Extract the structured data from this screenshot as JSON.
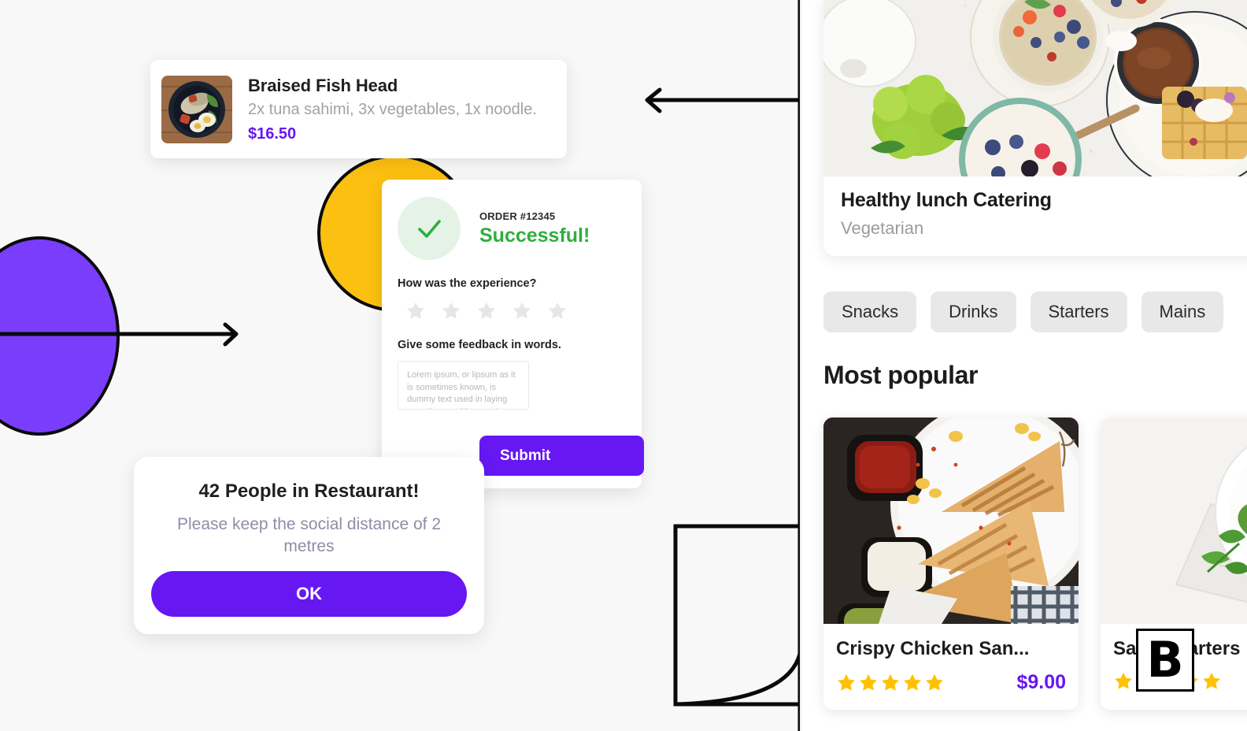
{
  "dish_card": {
    "title": "Braised Fish Head",
    "description": "2x tuna sahimi, 3x vegetables, 1x noodle.",
    "price": "$16.50",
    "thumb_alt": "braised-fish-head-bowl"
  },
  "feedback_card": {
    "order_label": "ORDER #12345",
    "status": "Successful!",
    "status_color": "#2fae3d",
    "rating_question": "How was the experience?",
    "rating_value": 0,
    "rating_max": 5,
    "feedback_label": "Give some feedback in words.",
    "feedback_value": "",
    "feedback_placeholder": "Lorem ipsum, or lipsum as it is sometimes known, is dummy text used in laying out print, graphic or web designs.",
    "submit_label": "Submit"
  },
  "people_card": {
    "title": "42 People in Restaurant!",
    "message": "Please keep the social distance of 2 metres",
    "ok_label": "OK"
  },
  "app_panel": {
    "hero": {
      "title": "Healthy lunch Catering",
      "subtitle": "Vegetarian",
      "image_alt": "brunch-flatlay-bowls-waffle-coffee"
    },
    "categories": [
      {
        "label": "Snacks"
      },
      {
        "label": "Drinks"
      },
      {
        "label": "Starters"
      },
      {
        "label": "Mains"
      }
    ],
    "section_title": "Most popular",
    "items": [
      {
        "name": "Crispy Chicken San...",
        "price": "$9.00",
        "rating": 5,
        "badge": "star-badge",
        "image_alt": "grilled-sandwich-with-dips"
      },
      {
        "name": "Salad Starters",
        "price": "",
        "rating": 5,
        "badge": "",
        "image_alt": "salad-bowl-on-marble"
      }
    ]
  },
  "watermark": {
    "letter": "B"
  },
  "colors": {
    "accent_purple": "#6617f2",
    "shape_purple": "#7a3dfb",
    "shape_yellow": "#fcc011",
    "success_green": "#2fae3d",
    "star_gold": "#ffc107",
    "star_empty": "#e6e6e6"
  }
}
